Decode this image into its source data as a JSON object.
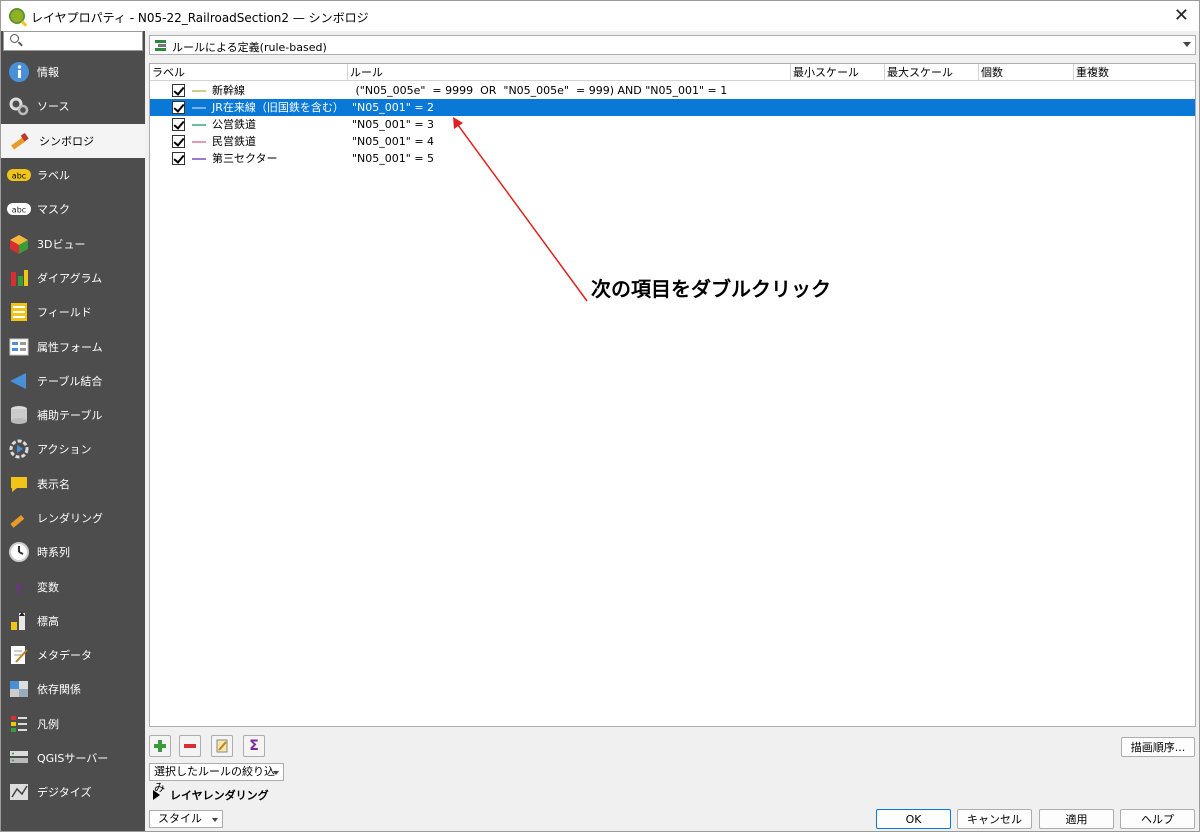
{
  "window": {
    "title": "レイヤプロパティ - N05-22_RailroadSection2 — シンボロジ",
    "close": "✕"
  },
  "sidebar": {
    "search_placeholder": "",
    "items": [
      {
        "label": "情報",
        "icon": "info-icon"
      },
      {
        "label": "ソース",
        "icon": "source-icon"
      },
      {
        "label": "シンボロジ",
        "icon": "symbology-icon",
        "active": true
      },
      {
        "label": "ラベル",
        "icon": "labels-icon"
      },
      {
        "label": "マスク",
        "icon": "mask-icon"
      },
      {
        "label": "3Dビュー",
        "icon": "3d-view-icon"
      },
      {
        "label": "ダイアグラム",
        "icon": "diagram-icon"
      },
      {
        "label": "フィールド",
        "icon": "fields-icon"
      },
      {
        "label": "属性フォーム",
        "icon": "attribute-form-icon"
      },
      {
        "label": "テーブル結合",
        "icon": "joins-icon"
      },
      {
        "label": "補助テーブル",
        "icon": "auxiliary-storage-icon"
      },
      {
        "label": "アクション",
        "icon": "actions-icon"
      },
      {
        "label": "表示名",
        "icon": "display-icon"
      },
      {
        "label": "レンダリング",
        "icon": "rendering-icon"
      },
      {
        "label": "時系列",
        "icon": "temporal-icon"
      },
      {
        "label": "変数",
        "icon": "variables-icon"
      },
      {
        "label": "標高",
        "icon": "elevation-icon"
      },
      {
        "label": "メタデータ",
        "icon": "metadata-icon"
      },
      {
        "label": "依存関係",
        "icon": "dependencies-icon"
      },
      {
        "label": "凡例",
        "icon": "legend-icon"
      },
      {
        "label": "QGISサーバー",
        "icon": "qgis-server-icon"
      },
      {
        "label": "デジタイズ",
        "icon": "digitizing-icon"
      }
    ]
  },
  "renderer": {
    "label": "ルールによる定義(rule-based)"
  },
  "tree": {
    "columns": [
      "ラベル",
      "ルール",
      "最小スケール",
      "最大スケール",
      "個数",
      "重複数"
    ],
    "rows": [
      {
        "label": "新幹線",
        "rule": " (\"N05_005e\"  = 9999  OR  \"N05_005e\"  = 999) AND \"N05_001\" = 1",
        "color": "#c8d08a",
        "checked": true
      },
      {
        "label": "JR在来線（旧国鉄を含む）",
        "rule": "\"N05_001\" = 2",
        "color": "#7ab4e6",
        "checked": true,
        "selected": true
      },
      {
        "label": "公営鉄道",
        "rule": "\"N05_001\" = 3",
        "color": "#62c49a",
        "checked": true
      },
      {
        "label": "民営鉄道",
        "rule": "\"N05_001\" = 4",
        "color": "#e39ab0",
        "checked": true
      },
      {
        "label": "第三セクター",
        "rule": "\"N05_001\" = 5",
        "color": "#9a7ad0",
        "checked": true
      }
    ]
  },
  "annotation": {
    "text": "次の項目をダブルクリック",
    "arrow_color": "#e02020"
  },
  "toolbar": {
    "add": "add-rule-icon",
    "remove": "remove-rule-icon",
    "edit": "edit-rule-icon",
    "sum": "Σ",
    "rendering_order": "描画順序..."
  },
  "filter_dropdown": "選択したルールの絞り込み",
  "layer_rendering": "レイヤレンダリング",
  "footer": {
    "style": "スタイル",
    "ok": "OK",
    "cancel": "キャンセル",
    "apply": "適用",
    "help": "ヘルプ"
  }
}
